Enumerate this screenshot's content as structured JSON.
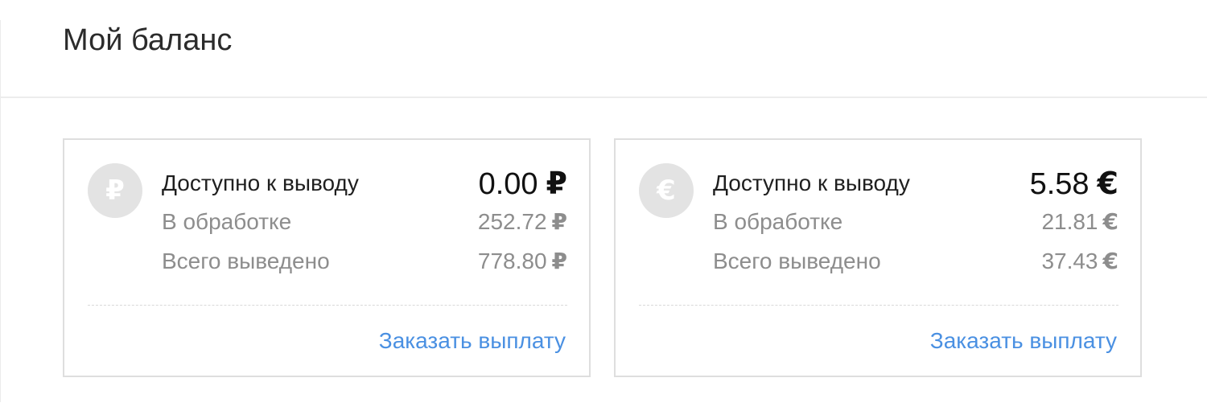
{
  "page": {
    "title": "Мой баланс"
  },
  "cards": [
    {
      "icon": "ruble-icon",
      "currency_symbol": "₽",
      "available_label": "Доступно к выводу",
      "available_value": "0.00",
      "processing_label": "В обработке",
      "processing_value": "252.72",
      "withdrawn_label": "Всего выведено",
      "withdrawn_value": "778.80",
      "action_label": "Заказать выплату"
    },
    {
      "icon": "euro-icon",
      "currency_symbol": "€",
      "available_label": "Доступно к выводу",
      "available_value": "5.58",
      "processing_label": "В обработке",
      "processing_value": "21.81",
      "withdrawn_label": "Всего выведено",
      "withdrawn_value": "37.43",
      "action_label": "Заказать выплату"
    }
  ],
  "colors": {
    "link": "#4a90e2",
    "icon_background": "#e3e3e3",
    "muted_text": "#8d8d8d",
    "card_border": "#dedede"
  }
}
